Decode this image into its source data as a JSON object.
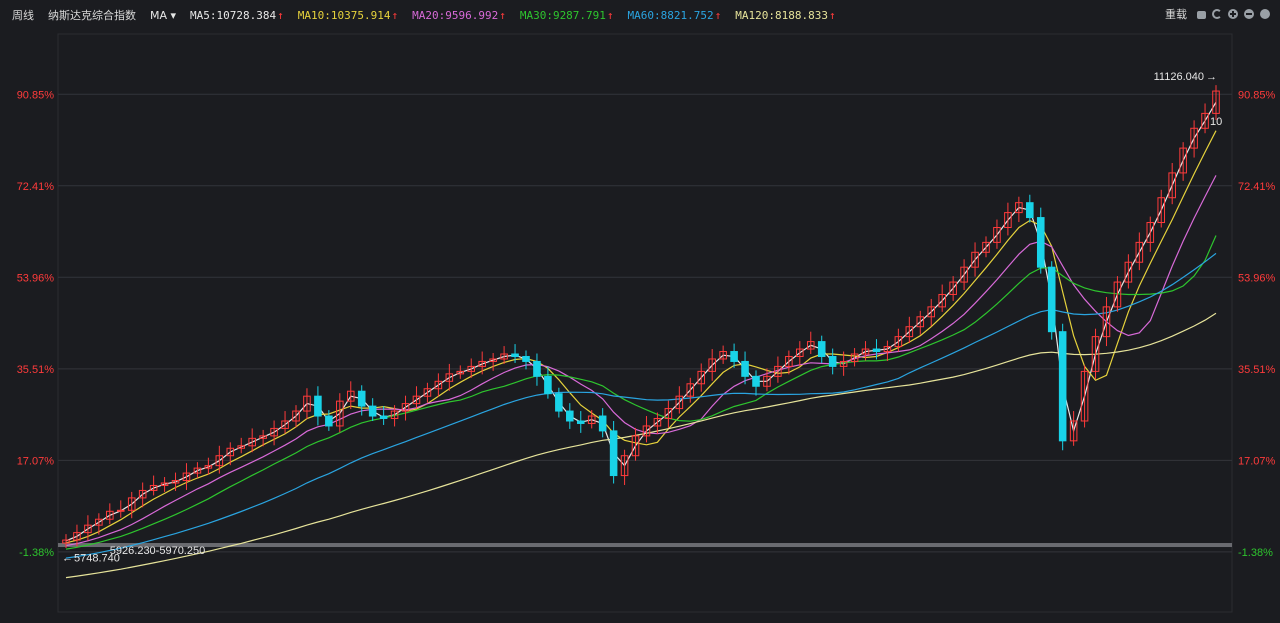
{
  "header": {
    "period": "周线",
    "symbol": "纳斯达克综合指数",
    "indicator": "MA",
    "reset": "重载"
  },
  "ma_lines": [
    {
      "label": "MA5:10728.384",
      "color": "#e8e8e8"
    },
    {
      "label": "MA10:10375.914",
      "color": "#e6d23c"
    },
    {
      "label": "MA20:9596.992",
      "color": "#d86ad8"
    },
    {
      "label": "MA30:9287.791",
      "color": "#2ec52e"
    },
    {
      "label": "MA60:8821.752",
      "color": "#2aa4e0"
    },
    {
      "label": "MA120:8188.833",
      "color": "#e6e39a"
    }
  ],
  "colors": {
    "background": "#1b1c20",
    "up": "#ff3b3b",
    "down": "#19d3e8",
    "grid": "#33343a",
    "pct_positive": "#ff3b3b",
    "pct_negative": "#2ec52e"
  },
  "chart_data": {
    "type": "candlestick",
    "y_axis": {
      "ticks": [
        "90.85%",
        "72.41%",
        "53.96%",
        "35.51%",
        "17.07%",
        "-1.38%"
      ],
      "tick_values": [
        90.85,
        72.41,
        53.96,
        35.51,
        17.07,
        -1.38
      ],
      "range": [
        -13.5,
        103.0
      ]
    },
    "annotations": {
      "high": "11126.040",
      "low": "5748.740",
      "low_range": "5926.230-5970.250",
      "last_marker": "10"
    },
    "close_series": [
      1.0,
      2.5,
      4.0,
      5.2,
      6.8,
      7.0,
      9.5,
      11.0,
      12.0,
      12.5,
      13.0,
      14.5,
      15.5,
      16.0,
      18.0,
      19.5,
      20.0,
      21.5,
      22.0,
      23.5,
      25.0,
      27.0,
      30.0,
      26.0,
      24.0,
      29.0,
      31.0,
      28.0,
      26.0,
      25.5,
      27.0,
      28.5,
      30.0,
      31.5,
      33.0,
      34.5,
      35.0,
      36.0,
      37.0,
      37.5,
      38.5,
      38.0,
      37.0,
      34.0,
      30.5,
      27.0,
      25.0,
      24.5,
      26.0,
      23.0,
      14.0,
      18.0,
      22.0,
      24.0,
      25.5,
      27.5,
      30.0,
      32.5,
      35.0,
      37.5,
      39.0,
      37.0,
      34.0,
      32.0,
      34.0,
      36.0,
      38.0,
      39.5,
      41.0,
      38.0,
      36.0,
      37.0,
      38.5,
      39.5,
      39.0,
      40.0,
      42.0,
      44.0,
      46.0,
      48.0,
      50.5,
      53.0,
      56.0,
      59.0,
      61.0,
      64.0,
      67.0,
      69.0,
      66.0,
      56.0,
      43.0,
      21.0,
      25.0,
      35.0,
      42.0,
      48.0,
      53.0,
      57.0,
      61.0,
      65.0,
      70.0,
      75.0,
      80.0,
      84.0,
      87.0,
      91.5
    ]
  }
}
